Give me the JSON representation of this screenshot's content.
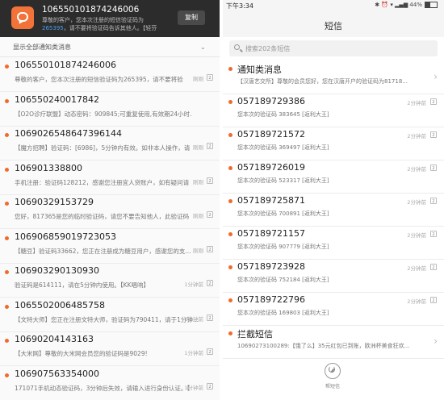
{
  "left": {
    "notification": {
      "title": "106550101874246006",
      "body_1": "尊敬的客户，您本次注册的短信验证码为",
      "body_link": "265395",
      "body_2": "，请不要将验证码告诉其他人。【轻芬",
      "copy_label": "复制"
    },
    "filter_label": "显示全部通知类消息",
    "filter_icon": "chevron-down-icon",
    "messages": [
      {
        "number": "106550101874246006",
        "preview": "尊敬的客户，您本次注册的短信验证码为265395，请不要将验",
        "time": "刚刚",
        "sim": "2"
      },
      {
        "number": "10655024001​7842",
        "preview": "【O2O诊疗联盟】动态密码：909845;可重复使用,有效期24小时.",
        "time": "",
        "sim": ""
      },
      {
        "number": "106902654864739​6144",
        "preview": "【魔方招聘】验证码：[6986]，5分钟内有效。如非本人操作，请",
        "time": "刚刚",
        "sim": "2"
      },
      {
        "number": "106901338800",
        "preview": "手机注册：验证码128212，感谢您注册宜人贷账户，如有疑问请",
        "time": "刚刚",
        "sim": "2"
      },
      {
        "number": "10690329153729",
        "preview": "您好，817365是您的临时验证码，请您不要告知他人，此验证码",
        "time": "刚刚",
        "sim": "2"
      },
      {
        "number": "106906859019723053",
        "preview": "【糖豆】验证码33662，您正在注册成为糖豆用户，感谢您的支...",
        "time": "刚刚",
        "sim": "2"
      },
      {
        "number": "10690329​0130930",
        "preview": "验证码是614111，请在5分钟内使用。【KK唱响】",
        "time": "1分钟前",
        "sim": "2"
      },
      {
        "number": "1065502006485758",
        "preview": "【文特大师】您正在注册文特大师，验证码为790411，请于1分钟...",
        "time": "1分钟前",
        "sim": "2"
      },
      {
        "number": "10690204143163",
        "preview": "【大米网】尊敬的大米网会员您的验证码是9029!",
        "time": "1分钟前",
        "sim": "2"
      },
      {
        "number": "10690756335400​0",
        "preview": "171071手机动态验证码，3分钟后失效，请输入进行身份认证。【",
        "time": "1分钟前",
        "sim": "2"
      }
    ]
  },
  "right": {
    "status_bar": {
      "time": "下午3:34",
      "icons": "✱ ⏰ ▾ ▂▄▆ 44%"
    },
    "title": "短信",
    "search_placeholder": "搜索202条短信",
    "rows": [
      {
        "title": "通知类消息",
        "preview": "【汉唐艺交所】尊敬的会员您好，您在汉唐开户的验证码为81718...",
        "time": "",
        "sim": "",
        "dot": true,
        "arrow": true
      },
      {
        "title": "057189729386",
        "preview": "您本次的验证码 383645 [返利大王]",
        "time": "2分钟前",
        "sim": "2",
        "dot": true,
        "arrow": false
      },
      {
        "title": "057189721572",
        "preview": "您本次的验证码 369497 [返利大王]",
        "time": "2分钟前",
        "sim": "2",
        "dot": true,
        "arrow": false
      },
      {
        "title": "057189726019",
        "preview": "您本次的验证码 523317 [返利大王]",
        "time": "2分钟前",
        "sim": "2",
        "dot": true,
        "arrow": false
      },
      {
        "title": "057189725871",
        "preview": "您本次的验证码 700891 [返利大王]",
        "time": "2分钟前",
        "sim": "2",
        "dot": true,
        "arrow": false
      },
      {
        "title": "057189721157",
        "preview": "您本次的验证码 907779 [返利大王]",
        "time": "2分钟前",
        "sim": "2",
        "dot": true,
        "arrow": false
      },
      {
        "title": "057189723928",
        "preview": "您本次的验证码 752184 [返利大王]",
        "time": "2分钟前",
        "sim": "2",
        "dot": true,
        "arrow": false
      },
      {
        "title": "057189722796",
        "preview": "您本次的验证码 169803 [返利大王]",
        "time": "2分钟前",
        "sim": "2",
        "dot": true,
        "arrow": false
      },
      {
        "title": "拦截短信",
        "preview": "10690273100289:【饿了么】35元红包已到账，欧洲杯美食狂欢...",
        "time": "",
        "sim": "",
        "dot": true,
        "arrow": true
      }
    ],
    "helper_label": "帮短信",
    "helper_icon": "assist-icon"
  },
  "colors": {
    "accent_dot": "#f26a2a",
    "notif_bg": "#2c2c2c",
    "notif_icon": "#f2733a",
    "link": "#4a9ee8"
  }
}
